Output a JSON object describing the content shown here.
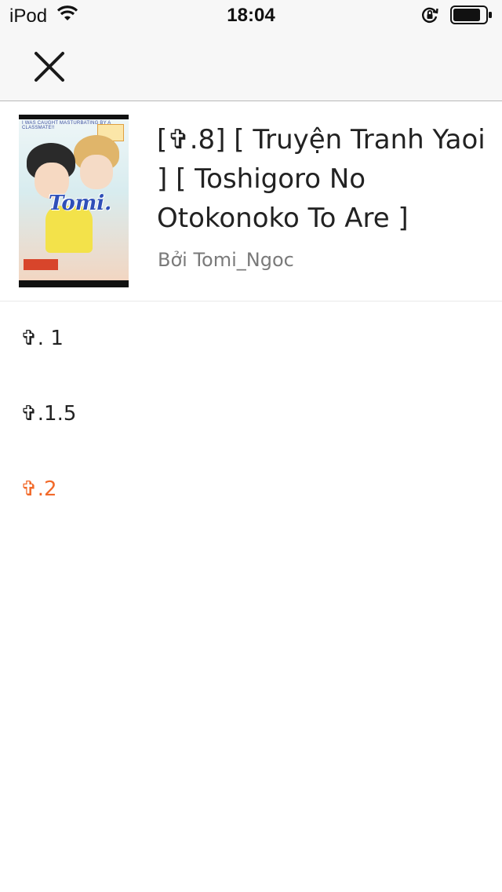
{
  "status_bar": {
    "device": "iPod",
    "time": "18:04",
    "icons": [
      "wifi-icon",
      "lock-rotation-icon",
      "battery-icon"
    ]
  },
  "nav_bar": {
    "close_icon": "close-icon"
  },
  "story": {
    "title": "[✞.8]   [ Truyện Tranh Yaoi ]   [ Toshigoro No Otokonoko To Are ]",
    "author": "Bởi Tomi_Ngoc",
    "cover": {
      "title": "Tomi.",
      "top_text": "I WAS CAUGHT MASTURBATING BY A CLASSMATE!!"
    }
  },
  "chapters": [
    {
      "label": "✞. 1",
      "current": false
    },
    {
      "label": "✞.1.5",
      "current": false
    },
    {
      "label": "✞.2",
      "current": true
    }
  ],
  "colors": {
    "accent": "#f26a2a",
    "text": "#222222",
    "secondary_text": "#7a7a7a",
    "bar_background": "#f7f7f7"
  }
}
